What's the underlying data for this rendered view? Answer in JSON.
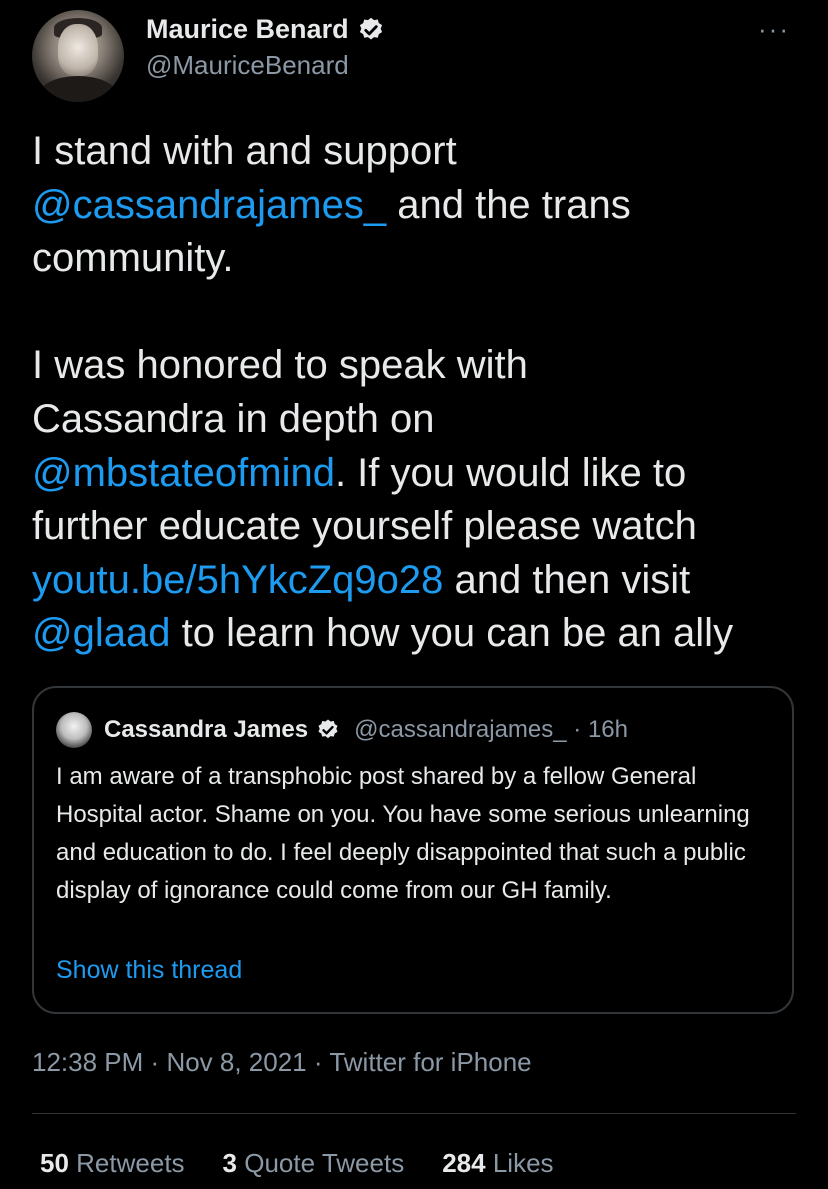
{
  "author": {
    "display_name": "Maurice Benard",
    "handle": "@MauriceBenard",
    "verified": true
  },
  "more_menu": "···",
  "tweet": {
    "segments": [
      {
        "text": "I stand with and support\n",
        "link": false
      },
      {
        "text": "@cassandrajames_",
        "link": true
      },
      {
        "text": " and the trans\ncommunity.\n\nI was honored to speak with\nCassandra in depth on\n",
        "link": false
      },
      {
        "text": "@mbstateofmind",
        "link": true
      },
      {
        "text": ". If you would like to\nfurther educate yourself please watch\n",
        "link": false
      },
      {
        "text": "youtu.be/5hYkcZq9o28",
        "link": true
      },
      {
        "text": " and then visit\n",
        "link": false
      },
      {
        "text": "@glaad",
        "link": true
      },
      {
        "text": " to learn how you can be an ally",
        "link": false
      }
    ]
  },
  "quote": {
    "author_name": "Cassandra James",
    "author_handle": "@cassandrajames_",
    "separator": "·",
    "time": "16h",
    "verified": true,
    "text": "I am aware of a transphobic post shared by a fellow General Hospital actor. Shame on you. You have some serious unlearning and education to do. I feel deeply disappointed that such a public display of ignorance could come from our GH family.",
    "show_thread": "Show this thread"
  },
  "meta": {
    "time": "12:38 PM",
    "date": "Nov 8, 2021",
    "source": "Twitter for iPhone",
    "separator": "·"
  },
  "stats": [
    {
      "value": "50",
      "label": "Retweets"
    },
    {
      "value": "3",
      "label": "Quote Tweets"
    },
    {
      "value": "284",
      "label": "Likes"
    }
  ],
  "colors": {
    "background": "#000000",
    "text": "#e7e9ea",
    "secondary": "#8b98a5",
    "link": "#1d9bf0",
    "border": "#333639"
  }
}
